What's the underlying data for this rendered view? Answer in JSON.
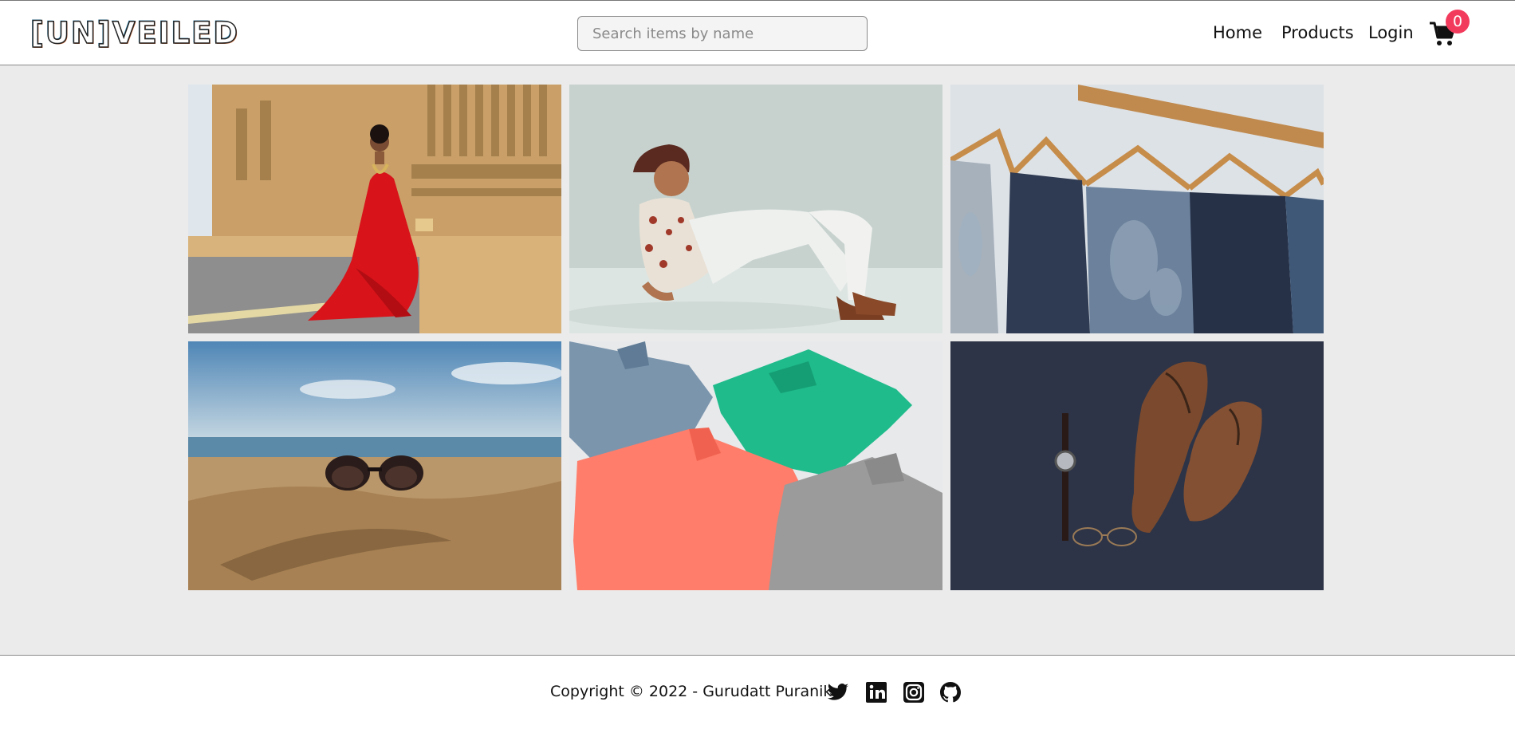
{
  "header": {
    "logo_text": "[UN]VEILED",
    "search": {
      "placeholder": "Search items by name",
      "value": ""
    },
    "nav": {
      "home": "Home",
      "products": "Products",
      "login": "Login"
    },
    "cart": {
      "count": "0",
      "icon": "cart-icon"
    }
  },
  "gallery": {
    "tiles": [
      {
        "name": "saree-temple-photo"
      },
      {
        "name": "sherwani-man-photo"
      },
      {
        "name": "jeans-rack-photo"
      },
      {
        "name": "sunglasses-sand-photo"
      },
      {
        "name": "polo-shirts-photo"
      },
      {
        "name": "shoes-watch-photo"
      }
    ]
  },
  "footer": {
    "copyright": "Copyright © 2022 - Gurudatt Puranik",
    "social": [
      "twitter-icon",
      "linkedin-icon",
      "instagram-icon",
      "github-icon"
    ]
  },
  "colors": {
    "badge": "#f23a5c",
    "page_bg": "#ebebeb",
    "header_bg": "#ffffff"
  }
}
